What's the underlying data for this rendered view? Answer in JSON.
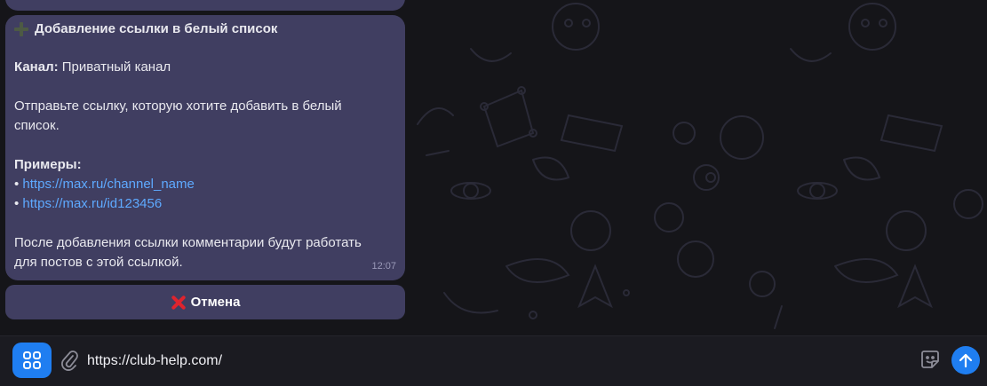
{
  "message": {
    "title": "Добавление ссылки в белый список",
    "channel_label": "Канал:",
    "channel_value": " Приватный канал",
    "instruction_line1": "Отправьте ссылку, которую хотите добавить в белый",
    "instruction_line2": "список.",
    "examples_label": "Примеры:",
    "bullet": "• ",
    "example_links": [
      "https://max.ru/channel_name",
      "https://max.ru/id123456"
    ],
    "note_line1": "После добавления ссылки комментарии будут работать",
    "note_line2": "для постов с этой ссылкой.",
    "time": "12:07"
  },
  "cancel_button": {
    "label": "Отмена",
    "icon": "cross-mark-icon",
    "icon_color": "#e0242e"
  },
  "composer": {
    "input_value": "https://club-help.com/",
    "apps_icon": "apps-grid-icon",
    "attach_icon": "paperclip-icon",
    "sticker_icon": "sticker-icon",
    "send_icon": "arrow-up-icon"
  },
  "colors": {
    "bubble": "#403e61",
    "accent": "#1f7ef1",
    "link": "#5ea9ff",
    "background": "#151519"
  }
}
